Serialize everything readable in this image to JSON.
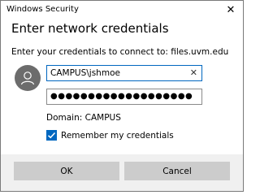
{
  "window": {
    "title": "Windows Security",
    "close_glyph": "✕"
  },
  "dialog": {
    "heading": "Enter network credentials",
    "prompt": "Enter your credentials to connect to: files.uvm.edu"
  },
  "form": {
    "username_value": "CAMPUS\\jshmoe",
    "clear_glyph": "✕",
    "password_masked": "●●●●●●●●●●●●●●●●●●●",
    "domain_text": "Domain: CAMPUS",
    "remember_label": "Remember my credentials",
    "remember_checked": true
  },
  "buttons": {
    "ok_label": "OK",
    "cancel_label": "Cancel"
  },
  "colors": {
    "accent": "#0067c0",
    "button_bg": "#cccccc",
    "footer_bg": "#f0f0f0",
    "avatar_bg": "#6c6c6c"
  },
  "icons": {
    "avatar": "user-avatar-icon",
    "check": "checkmark-icon"
  }
}
